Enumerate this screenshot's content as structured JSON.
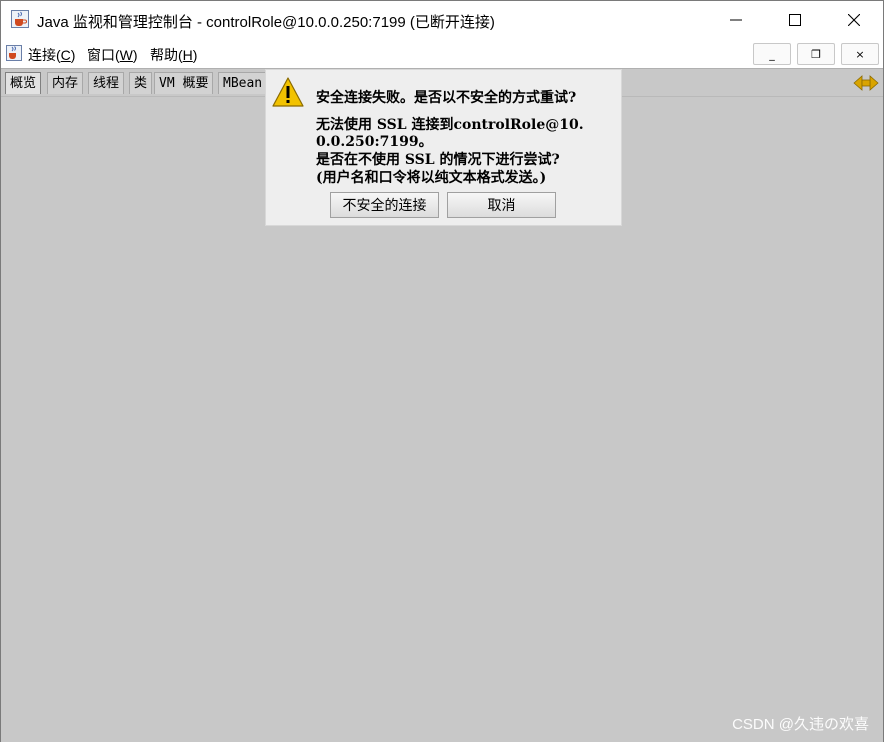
{
  "window": {
    "title": "Java 监视和管理控制台 - controlRole@10.0.0.250:7199 (已断开连接)",
    "minimize_glyph": "—",
    "maximize_glyph": "☐",
    "close_glyph": "✕"
  },
  "menubar": {
    "items": [
      {
        "label": "连接(",
        "mnemonic": "C",
        "suffix": ")"
      },
      {
        "label": "窗口(",
        "mnemonic": "W",
        "suffix": ")"
      },
      {
        "label": "帮助(",
        "mnemonic": "H",
        "suffix": ")"
      }
    ],
    "inner_min_glyph": "_",
    "inner_restore_glyph": "❐",
    "inner_close_glyph": "×"
  },
  "tabs": [
    "概览",
    "内存",
    "线程",
    "类",
    "VM 概要",
    "MBean"
  ],
  "dialog": {
    "lines": [
      "安全连接失败。是否以不安全的方式重试?",
      "无法使用 SSL 连接到controlRole@10.",
      "0.0.250:7199。",
      "是否在不使用 SSL 的情况下进行尝试?",
      "(用户名和口令将以纯文本格式发送。)"
    ],
    "insecure_button": "不安全的连接",
    "cancel_button": "取消"
  },
  "watermark": "CSDN @久违の欢喜",
  "colors": {
    "background": "#c8c8c8",
    "dialog": "#eeeeee",
    "warning": "#f2c200"
  }
}
